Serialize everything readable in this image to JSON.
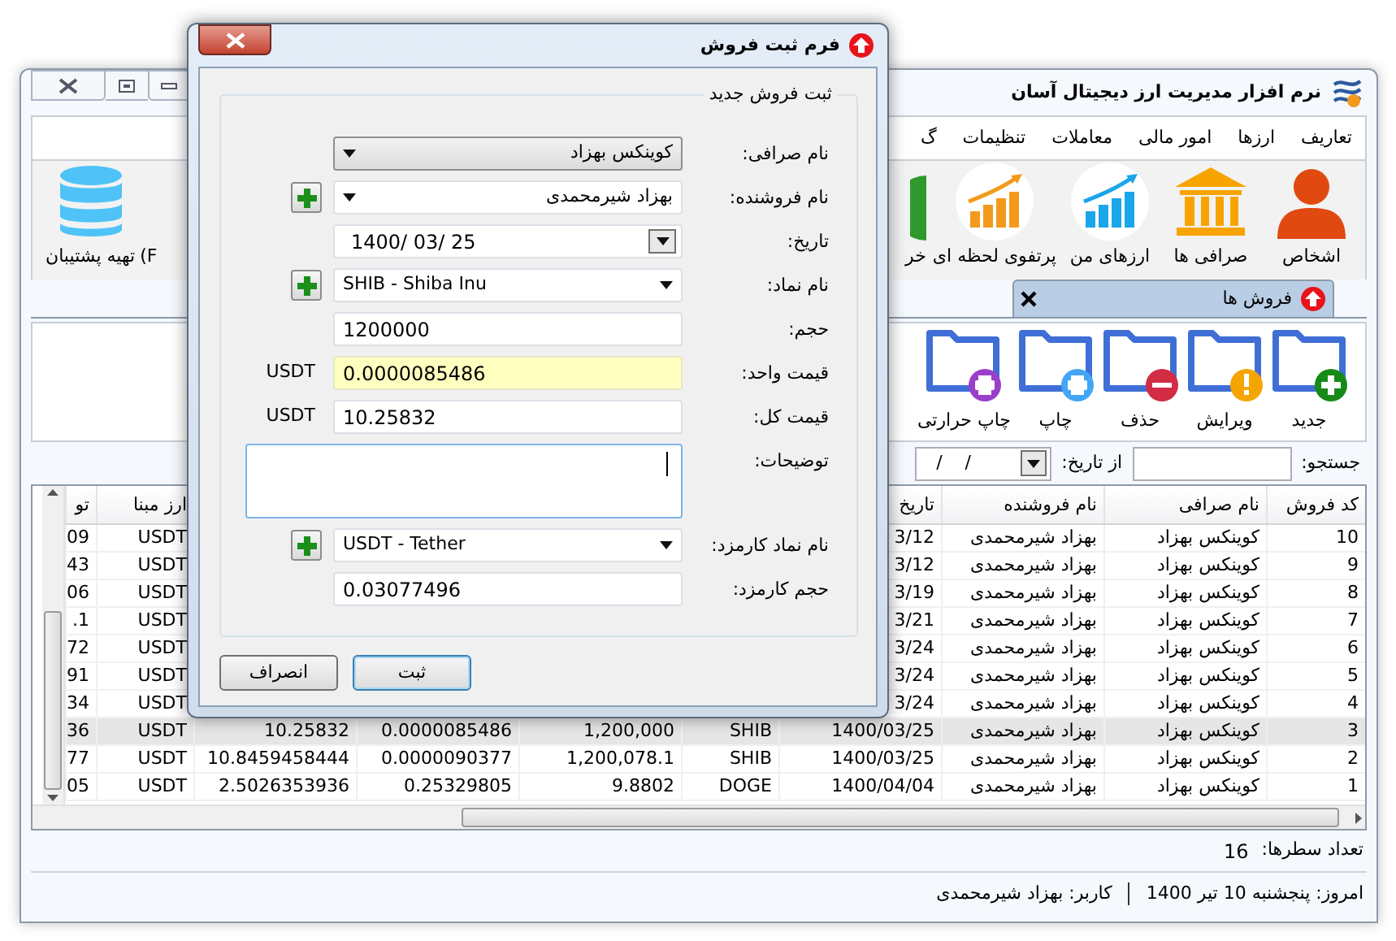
{
  "main_window": {
    "title": "نرم افزار مدیریت ارز دیجیتال آسان"
  },
  "menu": [
    "تعاریف",
    "ارزها",
    "امور مالی",
    "معاملات",
    "تنظیمات",
    "گ"
  ],
  "toolbar": [
    {
      "kind": "person",
      "label": "اشخاص"
    },
    {
      "kind": "bank",
      "label": "صرافی ها"
    },
    {
      "kind": "chart-blue",
      "label": "ارزهای من"
    },
    {
      "kind": "chart-orange",
      "label": "پرتفوی لحظه ای"
    },
    {
      "kind": "partial",
      "label": "خر"
    }
  ],
  "toolbar_left": [
    {
      "kind": "fragment",
      "label": "(F"
    },
    {
      "kind": "database",
      "label": "تهیه پشتیبان"
    }
  ],
  "tabs": [
    {
      "label": "فروش ها",
      "selected": true
    }
  ],
  "actions": [
    {
      "kind": "add",
      "label": "جدید"
    },
    {
      "kind": "edit",
      "label": "ویرایش"
    },
    {
      "kind": "delete",
      "label": "حذف"
    },
    {
      "kind": "print",
      "label": "چاپ"
    },
    {
      "kind": "thermal-print",
      "label": "چاپ حرارتی"
    }
  ],
  "search": {
    "label": "جستجو:",
    "from_date_label": "از تاریخ:",
    "from_date": "/    /"
  },
  "table": {
    "columns": [
      "کد فروش",
      "نام صرافی",
      "نام فروشنده",
      "تاریخ",
      null,
      null,
      null,
      null,
      "ارز مبنا",
      "تو"
    ],
    "rows": [
      {
        "selected": false,
        "cells": [
          "10",
          "کوینکس بهزاد",
          "بهزاد شیرمحمدی",
          "3/12",
          null,
          null,
          null,
          null,
          "USDT",
          "09"
        ]
      },
      {
        "selected": false,
        "cells": [
          "9",
          "کوینکس بهزاد",
          "بهزاد شیرمحمدی",
          "3/12",
          null,
          null,
          null,
          null,
          "USDT",
          "43"
        ]
      },
      {
        "selected": false,
        "cells": [
          "8",
          "کوینکس بهزاد",
          "بهزاد شیرمحمدی",
          "3/19",
          null,
          null,
          null,
          null,
          "USDT",
          "06"
        ]
      },
      {
        "selected": false,
        "cells": [
          "7",
          "کوینکس بهزاد",
          "بهزاد شیرمحمدی",
          "3/21",
          null,
          null,
          null,
          null,
          "USDT",
          ".1"
        ]
      },
      {
        "selected": false,
        "cells": [
          "6",
          "کوینکس بهزاد",
          "بهزاد شیرمحمدی",
          "3/24",
          null,
          null,
          null,
          null,
          "USDT",
          "72"
        ]
      },
      {
        "selected": false,
        "cells": [
          "5",
          "کوینکس بهزاد",
          "بهزاد شیرمحمدی",
          "3/24",
          null,
          null,
          null,
          null,
          "USDT",
          "91"
        ]
      },
      {
        "selected": false,
        "cells": [
          "4",
          "کوینکس بهزاد",
          "بهزاد شیرمحمدی",
          "3/24",
          null,
          null,
          null,
          null,
          "USDT",
          "34"
        ]
      },
      {
        "selected": true,
        "cells": [
          "3",
          "کوینکس بهزاد",
          "بهزاد شیرمحمدی",
          "1400/03/25",
          "SHIB",
          "1,200,000",
          "0.0000085486",
          "10.25832",
          "USDT",
          "36"
        ]
      },
      {
        "selected": false,
        "cells": [
          "2",
          "کوینکس بهزاد",
          "بهزاد شیرمحمدی",
          "1400/03/25",
          "SHIB",
          "1,200,078.1",
          "0.0000090377",
          "10.8459458444",
          "USDT",
          "77"
        ]
      },
      {
        "selected": false,
        "cells": [
          "1",
          "کوینکس بهزاد",
          "بهزاد شیرمحمدی",
          "1400/04/04",
          "DOGE",
          "9.8802",
          "0.25329805",
          "2.5026353936",
          "USDT",
          "05"
        ]
      }
    ]
  },
  "row_count": {
    "label": "تعداد سطرها:",
    "value": "16"
  },
  "status_bar": [
    "امروز: پنجشنبه 10 تیر 1400",
    "کاربر: بهزاد شیرمحمدی"
  ],
  "dialog": {
    "title": "فرم ثبت فروش",
    "legend": "ثبت فروش جدید",
    "fields": [
      {
        "kind": "dropdown",
        "label": "نام صرافی:",
        "value": "کوینکس بهزاد",
        "add_button": false,
        "highlighted": false,
        "focused": false
      },
      {
        "kind": "combo",
        "label": "نام فروشنده:",
        "value": "بهزاد شیرمحمدی",
        "add_button": true,
        "highlighted": false,
        "focused": false
      },
      {
        "kind": "date",
        "label": "تاریخ:",
        "value": "1400/ 03/ 25",
        "add_button": false,
        "highlighted": false,
        "focused": false
      },
      {
        "kind": "combo",
        "label": "نام نماد:",
        "value": "SHIB - Shiba Inu",
        "add_button": true,
        "highlighted": false,
        "focused": false
      },
      {
        "kind": "text",
        "label": "حجم:",
        "value": "1200000",
        "add_button": false,
        "highlighted": false,
        "focused": false
      },
      {
        "kind": "text",
        "label": "قیمت واحد:",
        "value": "0.0000085486",
        "unit": "USDT",
        "add_button": false,
        "highlighted": true,
        "focused": false
      },
      {
        "kind": "text",
        "label": "قیمت کل:",
        "value": "10.25832",
        "unit": "USDT",
        "add_button": false,
        "highlighted": false,
        "focused": false
      },
      {
        "kind": "textarea",
        "label": "توضیحات:",
        "add_button": false,
        "highlighted": false,
        "focused": true
      },
      {
        "kind": "combo",
        "label": "نام نماد کارمزد:",
        "value": "USDT - Tether",
        "add_button": true,
        "highlighted": false,
        "focused": false
      },
      {
        "kind": "text",
        "label": "حجم کارمزد:",
        "value": "0.03077496",
        "add_button": false,
        "highlighted": false,
        "focused": false
      }
    ],
    "buttons": [
      {
        "label": "ثبت",
        "default": true
      },
      {
        "label": "انصراف",
        "default": false
      }
    ]
  }
}
